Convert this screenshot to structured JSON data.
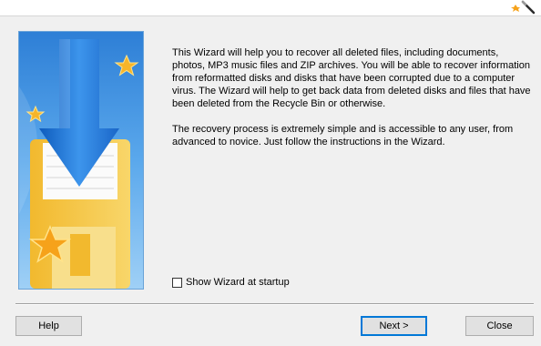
{
  "description": {
    "paragraph1": "This Wizard will help you to recover all deleted files, including documents, photos, MP3 music files and ZIP archives. You will be able to recover information from reformatted disks and disks that have been corrupted due to a computer virus. The Wizard will help to get back data from deleted disks and files that have been deleted from the Recycle Bin or otherwise.",
    "paragraph2": "The recovery process is extremely simple and is accessible to any user, from advanced to novice. Just follow the instructions in the Wizard."
  },
  "startup_checkbox": {
    "label": "Show Wizard at startup",
    "checked": false
  },
  "buttons": {
    "help": "Help",
    "next": "Next >",
    "close": "Close"
  },
  "colors": {
    "banner_bg": "#3a8fe0",
    "arrow": "#1f6fd1",
    "disk": "#f4c23c",
    "star": "#f7b52a",
    "focus": "#0078d7"
  },
  "icons": {
    "header": "wizard-wand-icon",
    "banner": "download-floppy-illustration"
  }
}
